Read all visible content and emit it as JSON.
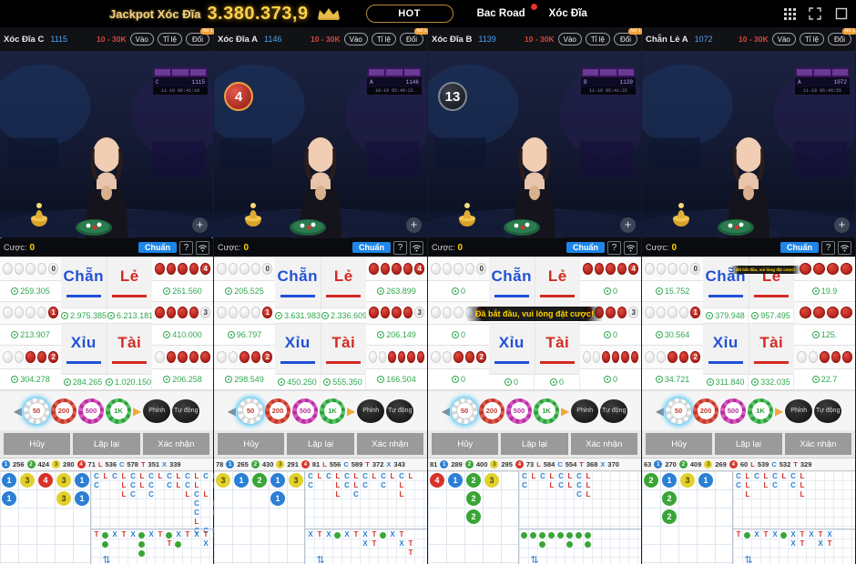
{
  "topbar": {
    "jackpot_label": "Jackpot Xóc Đĩa",
    "jackpot_value": "3.380.373,9",
    "hot_label": "HOT",
    "nav": [
      {
        "label": "Bac Road",
        "has_dot": true
      },
      {
        "label": "Xóc Đĩa",
        "has_dot": false
      }
    ],
    "icons": [
      "apps-grid-icon",
      "expand-icon",
      "window-icon"
    ]
  },
  "common": {
    "limit": "10 - 30K",
    "btn_vao": "Vào",
    "btn_tile": "Tỉ lệ",
    "btn_doi": "Đổi",
    "badge_text": "Nổ 1",
    "bet_label": "Cược:",
    "chuan": "Chuẩn",
    "help": "?",
    "notice": "Đã bắt đầu, vui lòng đặt cược!",
    "chips": [
      {
        "value": "50",
        "cls": "c50",
        "selected": true
      },
      {
        "value": "200",
        "cls": "c200",
        "selected": false
      },
      {
        "value": "500",
        "cls": "c500",
        "selected": false
      },
      {
        "value": "1K",
        "cls": "c1k",
        "selected": false
      }
    ],
    "chip_extra": [
      "Phỉnh",
      "Tự động"
    ],
    "actions": [
      "Hủy",
      "Lặp lại",
      "Xác nhận"
    ],
    "bets": {
      "chan": "Chẵn",
      "le": "Lẻ",
      "xiu": "Xỉu",
      "tai": "Tài"
    },
    "colors": {
      "blue": "#2050d8",
      "red": "#d42a22",
      "green": "#2fa84f",
      "gold": "#ffd400",
      "accent": "#1e86e8"
    }
  },
  "panels": [
    {
      "name": "Xóc Đĩa  C",
      "table_id": "1115",
      "selected": true,
      "bet_total": "0",
      "countdown": null,
      "overlay": {
        "code": "C",
        "id": "1115",
        "time": "11-19 06:41:10"
      },
      "notice_visible": false,
      "left_rows": [
        {
          "balls": "wwww",
          "num": "0",
          "num_color": "w",
          "amount": "259.305"
        },
        {
          "balls": "wwww",
          "num": "1",
          "num_color": "r",
          "amount": "213.907"
        },
        {
          "balls": "wwrr",
          "num": "2",
          "num_color": "r",
          "amount": "304.278"
        }
      ],
      "right_rows": [
        {
          "balls": "rrrr",
          "num": "4",
          "num_color": "r",
          "amount": "261.560"
        },
        {
          "balls": "rrrr",
          "num": "3",
          "num_color": "w",
          "amount": "410.000"
        },
        {
          "balls": "wrrrr",
          "num": "",
          "num_color": "",
          "amount": "206.258"
        }
      ],
      "chan_amt": "2.975.385",
      "le_amt": "6.213.181",
      "xiu_amt": "284.265",
      "tai_amt": "1.020.150",
      "stats": [
        {
          "type": "dot",
          "cls": "sd1",
          "label": "1",
          "value": "256"
        },
        {
          "type": "dot",
          "cls": "sd2",
          "label": "2",
          "value": "424"
        },
        {
          "type": "dot",
          "cls": "sd3",
          "label": "3",
          "value": "280"
        },
        {
          "type": "dot",
          "cls": "sd0",
          "label": "4",
          "value": "71"
        },
        {
          "type": "ltr",
          "cls": "sL",
          "label": "L",
          "value": "536"
        },
        {
          "type": "ltr",
          "cls": "sC",
          "label": "C",
          "value": "578"
        },
        {
          "type": "ltr",
          "cls": "sT",
          "label": "T",
          "value": "351"
        },
        {
          "type": "ltr",
          "cls": "sX",
          "label": "X",
          "value": "339"
        }
      ],
      "beads": [
        {
          "c": 0,
          "r": 0,
          "cls": "b1",
          "n": "1"
        },
        {
          "c": 1,
          "r": 0,
          "cls": "b3",
          "n": "3"
        },
        {
          "c": 2,
          "r": 0,
          "cls": "b4",
          "n": "4"
        },
        {
          "c": 3,
          "r": 0,
          "cls": "b3",
          "n": "3"
        },
        {
          "c": 4,
          "r": 0,
          "cls": "b1",
          "n": "1"
        },
        {
          "c": 0,
          "r": 1,
          "cls": "b1",
          "n": "1"
        },
        {
          "c": 3,
          "r": 1,
          "cls": "b3",
          "n": "3"
        },
        {
          "c": 4,
          "r": 1,
          "cls": "b1",
          "n": "1"
        }
      ],
      "big_road": [
        "C L C L C L C L C L C L C L",
        "C . . L C L C . C L C L . L",
        ". . . L C . C . . . L C L . L",
        ". . . . . . . . . . . C . L . L",
        ". . . . . . . . . . . C . L",
        ". . . . . . . . . . . L",
        ". . . . . . . . . . . C C C"
      ],
      "bot_road": [
        "T * X T X * X T * X T X T X",
        ". * . . . * . . T * . . X T X",
        ". . . . . * . . . . . . . T",
        ". . . . . . . . . . . . . T"
      ]
    },
    {
      "name": "Xóc Đĩa  A",
      "table_id": "1146",
      "selected": false,
      "bet_total": "0",
      "countdown": "4",
      "countdown_style": "red",
      "overlay": {
        "code": "A",
        "id": "1146",
        "time": "10-19 05:40:21"
      },
      "notice_visible": false,
      "left_rows": [
        {
          "balls": "wwww",
          "num": "0",
          "num_color": "w",
          "amount": "205.525"
        },
        {
          "balls": "wwww",
          "num": "1",
          "num_color": "r",
          "amount": "96.797"
        },
        {
          "balls": "wwrr",
          "num": "2",
          "num_color": "r",
          "amount": "298.549"
        }
      ],
      "right_rows": [
        {
          "balls": "rrrr",
          "num": "4",
          "num_color": "r",
          "amount": "263.899"
        },
        {
          "balls": "rrrr",
          "num": "3",
          "num_color": "w",
          "amount": "206.149"
        },
        {
          "balls": "wwrrrr",
          "num": "",
          "num_color": "",
          "amount": "166.504"
        }
      ],
      "chan_amt": "3.631.983",
      "le_amt": "2.336.609",
      "xiu_amt": "450.250",
      "tai_amt": "555.350",
      "stats": [
        {
          "type": "val",
          "label": "",
          "value": "78"
        },
        {
          "type": "dot",
          "cls": "sd1",
          "label": "1",
          "value": "265"
        },
        {
          "type": "dot",
          "cls": "sd2",
          "label": "2",
          "value": "430"
        },
        {
          "type": "dot",
          "cls": "sd3",
          "label": "3",
          "value": "291"
        },
        {
          "type": "dot",
          "cls": "sd0",
          "label": "4",
          "value": "81"
        },
        {
          "type": "ltr",
          "cls": "sL",
          "label": "L",
          "value": "556"
        },
        {
          "type": "ltr",
          "cls": "sC",
          "label": "C",
          "value": "589"
        },
        {
          "type": "ltr",
          "cls": "sT",
          "label": "T",
          "value": "372"
        },
        {
          "type": "ltr",
          "cls": "sX",
          "label": "X",
          "value": "343"
        }
      ],
      "beads": [
        {
          "c": 0,
          "r": 0,
          "cls": "b3",
          "n": "3"
        },
        {
          "c": 1,
          "r": 0,
          "cls": "b1",
          "n": "1"
        },
        {
          "c": 2,
          "r": 0,
          "cls": "b2",
          "n": "2"
        },
        {
          "c": 3,
          "r": 0,
          "cls": "b1",
          "n": "1"
        },
        {
          "c": 4,
          "r": 0,
          "cls": "b3",
          "n": "3"
        },
        {
          "c": 3,
          "r": 1,
          "cls": "b1",
          "n": "1"
        }
      ],
      "big_road": [
        "C L C L C L C L C L C L",
        "C . . L C L C . C . L",
        ". . . L . C . . . . L"
      ],
      "bot_road": [
        "X T X * X T X T * X T",
        ". . . . . . X T . . X T",
        ". . . . . . . . . . . T"
      ]
    },
    {
      "name": "Xóc Đĩa  B",
      "table_id": "1139",
      "selected": false,
      "bet_total": "0",
      "countdown": "13",
      "countdown_style": "dark",
      "overlay": {
        "code": "B",
        "id": "1139",
        "time": "11-19 05:41:22"
      },
      "notice_visible": true,
      "left_rows": [
        {
          "balls": "wwww",
          "num": "0",
          "num_color": "w",
          "amount": "0"
        },
        {
          "balls": "wwww",
          "num": "1",
          "num_color": "r",
          "amount": "0"
        },
        {
          "balls": "wwrr",
          "num": "2",
          "num_color": "r",
          "amount": "0"
        }
      ],
      "right_rows": [
        {
          "balls": "rrrr",
          "num": "4",
          "num_color": "r",
          "amount": "0"
        },
        {
          "balls": "rrrr",
          "num": "3",
          "num_color": "w",
          "amount": "0"
        },
        {
          "balls": "wwrrrr",
          "num": "",
          "num_color": "",
          "amount": "0"
        }
      ],
      "chan_amt": "0",
      "le_amt": "0",
      "xiu_amt": "0",
      "tai_amt": "0",
      "stats": [
        {
          "type": "val",
          "label": "",
          "value": "81"
        },
        {
          "type": "dot",
          "cls": "sd1",
          "label": "1",
          "value": "289"
        },
        {
          "type": "dot",
          "cls": "sd2",
          "label": "2",
          "value": "400"
        },
        {
          "type": "dot",
          "cls": "sd3",
          "label": "3",
          "value": "295"
        },
        {
          "type": "dot",
          "cls": "sd0",
          "label": "4",
          "value": "73"
        },
        {
          "type": "ltr",
          "cls": "sL",
          "label": "L",
          "value": "584"
        },
        {
          "type": "ltr",
          "cls": "sC",
          "label": "C",
          "value": "554"
        },
        {
          "type": "ltr",
          "cls": "sT",
          "label": "T",
          "value": "368"
        },
        {
          "type": "ltr",
          "cls": "sX",
          "label": "X",
          "value": "370"
        }
      ],
      "beads": [
        {
          "c": 0,
          "r": 0,
          "cls": "b4",
          "n": "4"
        },
        {
          "c": 1,
          "r": 0,
          "cls": "b1",
          "n": "1"
        },
        {
          "c": 2,
          "r": 0,
          "cls": "b2",
          "n": "2"
        },
        {
          "c": 3,
          "r": 0,
          "cls": "b3",
          "n": "3"
        },
        {
          "c": 2,
          "r": 1,
          "cls": "b2",
          "n": "2"
        },
        {
          "c": 2,
          "r": 2,
          "cls": "b2",
          "n": "2"
        }
      ],
      "big_road": [
        "C L C L C L C L",
        "C . . L C L C L",
        ". . . . . . C L"
      ],
      "bot_road": [
        "* * * * * * * *",
        ". . * . . * . *"
      ]
    },
    {
      "name": "Chẵn Lẻ A",
      "table_id": "1072",
      "selected": false,
      "bet_total": "0",
      "countdown": null,
      "overlay": {
        "code": "A",
        "id": "1072",
        "time": "11-19 05:40:55"
      },
      "notice_visible": true,
      "notice_small": true,
      "left_rows": [
        {
          "balls": "wwww",
          "num": "0",
          "num_color": "w",
          "amount": "15.752"
        },
        {
          "balls": "wwww",
          "num": "1",
          "num_color": "r",
          "amount": "30.564"
        },
        {
          "balls": "wwrr",
          "num": "2",
          "num_color": "r",
          "amount": "34.721"
        }
      ],
      "right_rows": [
        {
          "balls": "rrrr",
          "num": "",
          "num_color": "",
          "amount": "19.9"
        },
        {
          "balls": "rrrr",
          "num": "",
          "num_color": "",
          "amount": "125."
        },
        {
          "balls": "wwrrr",
          "num": "",
          "num_color": "",
          "amount": "22.7"
        }
      ],
      "chan_amt": "379.948",
      "le_amt": "957.495",
      "xiu_amt": "311.840",
      "tai_amt": "332.035",
      "stats": [
        {
          "type": "val",
          "label": "",
          "value": "63"
        },
        {
          "type": "dot",
          "cls": "sd1",
          "label": "1",
          "value": "270"
        },
        {
          "type": "dot",
          "cls": "sd2",
          "label": "2",
          "value": "409"
        },
        {
          "type": "dot",
          "cls": "sd3",
          "label": "3",
          "value": "269"
        },
        {
          "type": "dot",
          "cls": "sd0",
          "label": "4",
          "value": "60"
        },
        {
          "type": "ltr",
          "cls": "sL",
          "label": "L",
          "value": "539"
        },
        {
          "type": "ltr",
          "cls": "sC",
          "label": "C",
          "value": "532"
        },
        {
          "type": "ltr",
          "cls": "sT",
          "label": "T",
          "value": "329"
        }
      ],
      "beads": [
        {
          "c": 0,
          "r": 0,
          "cls": "b2",
          "n": "2"
        },
        {
          "c": 1,
          "r": 0,
          "cls": "b1",
          "n": "1"
        },
        {
          "c": 2,
          "r": 0,
          "cls": "b3",
          "n": "3"
        },
        {
          "c": 3,
          "r": 0,
          "cls": "b1",
          "n": "1"
        },
        {
          "c": 1,
          "r": 1,
          "cls": "b2",
          "n": "2"
        },
        {
          "c": 1,
          "r": 2,
          "cls": "b2",
          "n": "2"
        }
      ],
      "big_road": [
        "C L C L C L C L",
        "C L . L C . C L",
        ". L . . . . . L"
      ],
      "bot_road": [
        "T * X T X * X T X T X",
        ". . . . . . X T . X T"
      ]
    }
  ]
}
